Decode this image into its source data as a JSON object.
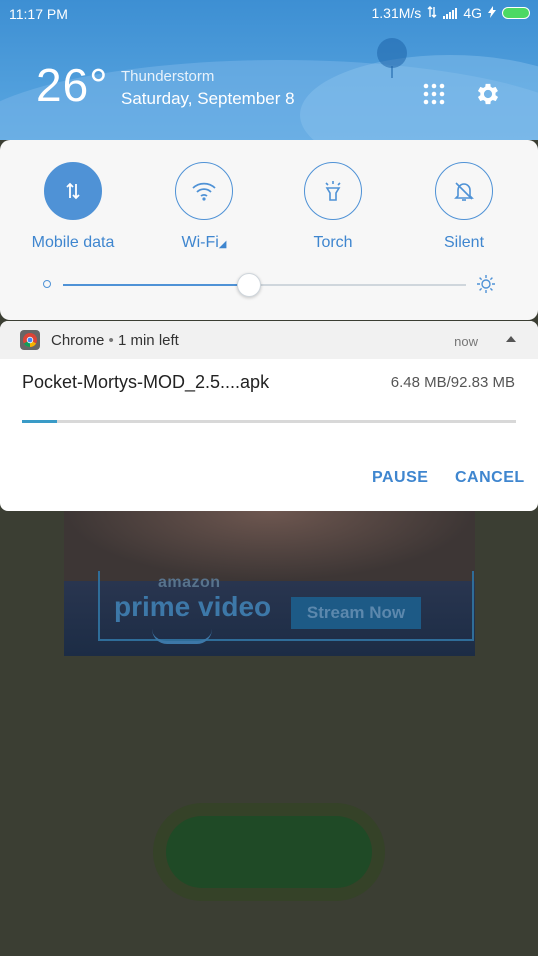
{
  "status_bar": {
    "time": "11:17 PM",
    "net_speed": "1.31M/s",
    "network_type": "4G"
  },
  "weather": {
    "temperature": "26°",
    "condition": "Thunderstorm",
    "date": "Saturday, September 8"
  },
  "quick_settings": {
    "toggles": [
      {
        "label": "Mobile data",
        "icon": "mobile-data-icon",
        "active": true
      },
      {
        "label": "Wi-Fi",
        "icon": "wifi-icon",
        "active": false
      },
      {
        "label": "Torch",
        "icon": "torch-icon",
        "active": false
      },
      {
        "label": "Silent",
        "icon": "bell-off-icon",
        "active": false
      }
    ],
    "brightness_fraction": 0.46
  },
  "notification": {
    "app": "Chrome",
    "subtitle": "1 min left",
    "separator": "•",
    "time": "now",
    "file_name": "Pocket-Mortys-MOD_2.5....apk",
    "file_size": "6.48 MB/92.83 MB",
    "progress_fraction": 0.07,
    "pause_label": "PAUSE",
    "cancel_label": "CANCEL"
  },
  "background_ad": {
    "brand": "amazon",
    "product": "prime video",
    "cta": "Stream Now"
  },
  "colors": {
    "accent": "#4f92d6",
    "header_blue": "#4b9ad9",
    "progress": "#3a9bc7"
  }
}
